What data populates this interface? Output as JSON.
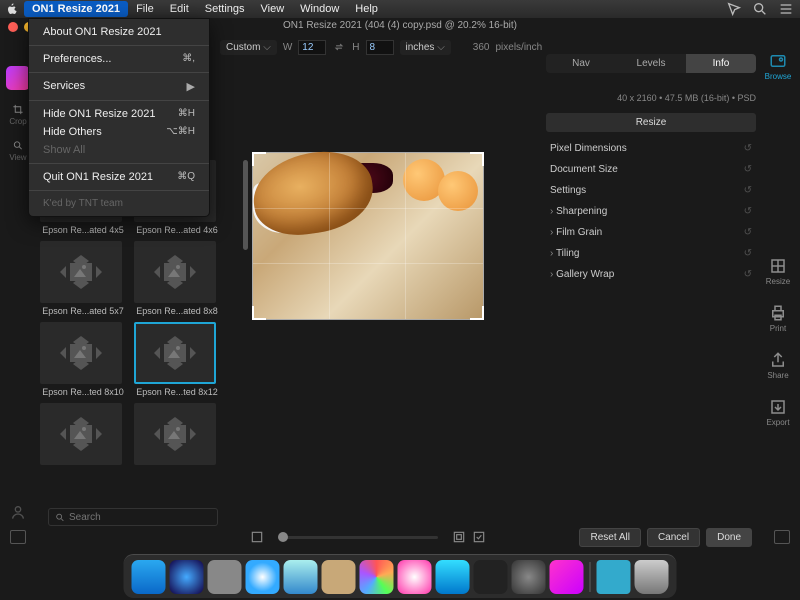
{
  "menubar": {
    "app_name": "ON1 Resize 2021",
    "items": [
      "File",
      "Edit",
      "Settings",
      "View",
      "Window",
      "Help"
    ]
  },
  "window_title": "ON1 Resize 2021 (404 (4) copy.psd @ 20.2% 16-bit)",
  "app_menu": {
    "about": "About ON1 Resize 2021",
    "preferences": "Preferences...",
    "preferences_shortcut": "⌘,",
    "services": "Services",
    "hide": "Hide ON1 Resize 2021",
    "hide_shortcut": "⌘H",
    "hide_others": "Hide Others",
    "hide_others_shortcut": "⌥⌘H",
    "show_all": "Show All",
    "quit": "Quit ON1 Resize 2021",
    "quit_shortcut": "⌘Q",
    "footer": "K'ed by TNT team"
  },
  "toolbar": {
    "preset": "Custom",
    "w_label": "W",
    "w_value": "12",
    "h_label": "H",
    "h_value": "8",
    "units": "inches",
    "ppi": "360",
    "ppi_unit": "pixels/inch"
  },
  "left_tools": {
    "crop": "Crop",
    "view": "View"
  },
  "presets": [
    {
      "label": "Epson Re...ated 4x5"
    },
    {
      "label": "Epson Re...ated 4x6"
    },
    {
      "label": "Epson Re...ated 5x7"
    },
    {
      "label": "Epson Re...ated 8x8"
    },
    {
      "label": "Epson Re...ted 8x10"
    },
    {
      "label": "Epson Re...ted 8x12",
      "selected": true
    },
    {
      "label": ""
    },
    {
      "label": ""
    }
  ],
  "search_placeholder": "Search",
  "right_tabs": [
    "Nav",
    "Levels",
    "Info"
  ],
  "right_tabs_active": 2,
  "info_line": "40 x 2160  •  47.5 MB (16-bit)  •  PSD",
  "panels": {
    "resize": "Resize",
    "pixel_dimensions": "Pixel Dimensions",
    "document_size": "Document Size",
    "settings": "Settings",
    "sharpening": "Sharpening",
    "film_grain": "Film Grain",
    "tiling": "Tiling",
    "gallery_wrap": "Gallery Wrap"
  },
  "right_rail": {
    "browse": "Browse",
    "resize": "Resize",
    "print": "Print",
    "share": "Share",
    "export": "Export"
  },
  "bottom": {
    "reset_all": "Reset All",
    "cancel": "Cancel",
    "done": "Done"
  },
  "dock_apps": [
    "finder",
    "siri",
    "launchpad",
    "safari",
    "mail",
    "contacts",
    "photos",
    "itunes",
    "appstore",
    "terminal",
    "settings",
    "on1",
    "downloads",
    "trash"
  ]
}
